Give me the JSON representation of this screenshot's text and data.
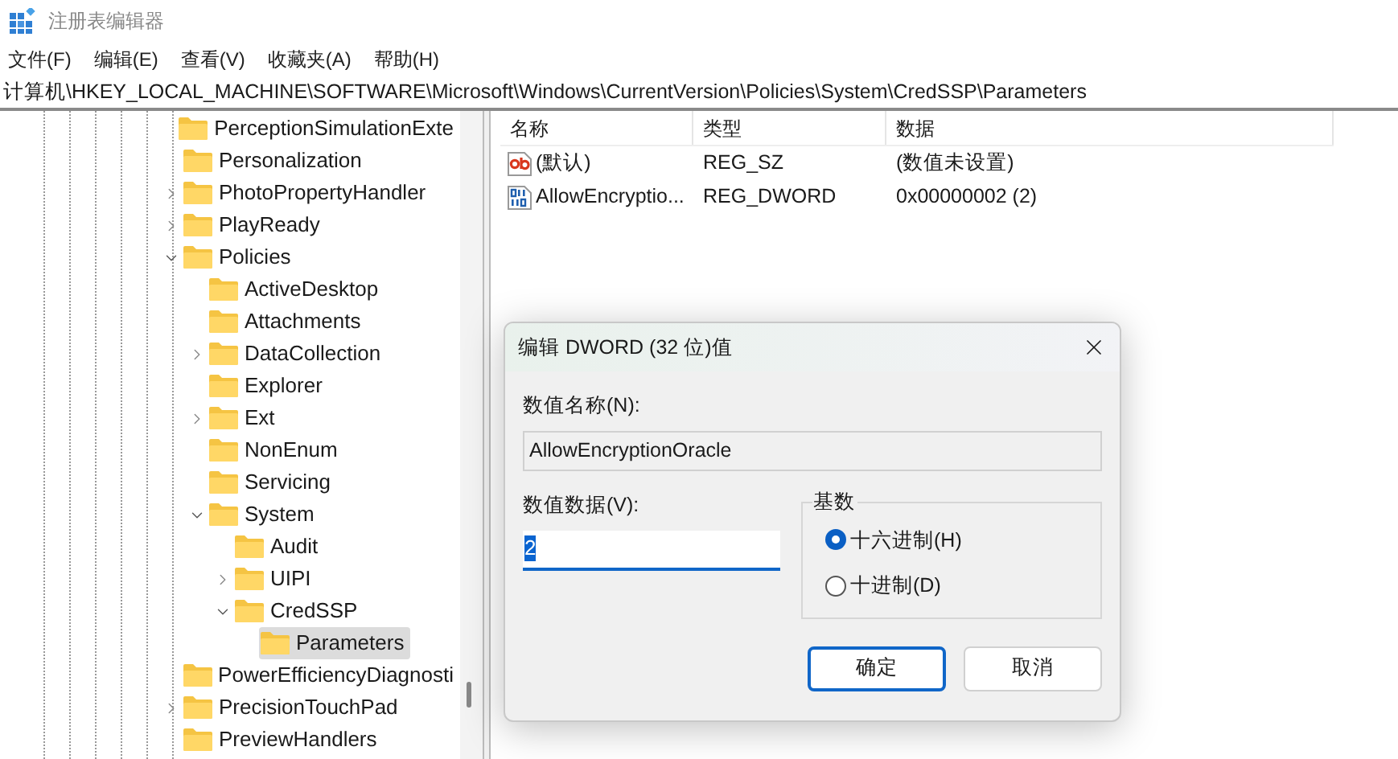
{
  "window": {
    "title": "注册表编辑器"
  },
  "menu": [
    "文件(F)",
    "编辑(E)",
    "查看(V)",
    "收藏夹(A)",
    "帮助(H)"
  ],
  "address": "计算机\\HKEY_LOCAL_MACHINE\\SOFTWARE\\Microsoft\\Windows\\CurrentVersion\\Policies\\System\\CredSSP\\Parameters",
  "tree": [
    {
      "label": "PerceptionSimulationExte",
      "selected": false
    },
    {
      "label": "Personalization",
      "selected": false
    },
    {
      "label": "PhotoPropertyHandler",
      "selected": false,
      "expanded": false
    },
    {
      "label": "PlayReady",
      "selected": false,
      "expanded": false
    },
    {
      "label": "Policies",
      "selected": false,
      "expanded": true,
      "children": [
        {
          "label": "ActiveDesktop",
          "selected": false
        },
        {
          "label": "Attachments",
          "selected": false
        },
        {
          "label": "DataCollection",
          "selected": false,
          "expanded": false
        },
        {
          "label": "Explorer",
          "selected": false
        },
        {
          "label": "Ext",
          "selected": false,
          "expanded": false
        },
        {
          "label": "NonEnum",
          "selected": false
        },
        {
          "label": "Servicing",
          "selected": false
        },
        {
          "label": "System",
          "selected": false,
          "expanded": true,
          "children": [
            {
              "label": "Audit",
              "selected": false
            },
            {
              "label": "UIPI",
              "selected": false,
              "expanded": false
            },
            {
              "label": "CredSSP",
              "selected": false,
              "expanded": true,
              "children": [
                {
                  "label": "Parameters",
                  "selected": true
                }
              ]
            }
          ]
        }
      ]
    },
    {
      "label": "PowerEfficiencyDiagnosti",
      "selected": false
    },
    {
      "label": "PrecisionTouchPad",
      "selected": false,
      "expanded": false
    },
    {
      "label": "PreviewHandlers",
      "selected": false
    }
  ],
  "list": {
    "columns": [
      "名称",
      "类型",
      "数据"
    ],
    "rows": [
      {
        "kind": "string",
        "name": "(默认)",
        "type": "REG_SZ",
        "data": "(数值未设置)"
      },
      {
        "kind": "binary",
        "name": "AllowEncryptio...",
        "type": "REG_DWORD",
        "data": "0x00000002 (2)"
      }
    ]
  },
  "dialog": {
    "title": "编辑 DWORD (32 位)值",
    "name_label": "数值名称(N):",
    "name_value": "AllowEncryptionOracle",
    "data_label": "数值数据(V):",
    "data_value": "2",
    "base_label": "基数",
    "bases": [
      {
        "label": "十六进制(H)",
        "selected": true
      },
      {
        "label": "十进制(D)",
        "selected": false
      }
    ],
    "buttons": [
      {
        "label": "确定",
        "default": true
      },
      {
        "label": "取消",
        "default": false
      }
    ]
  }
}
